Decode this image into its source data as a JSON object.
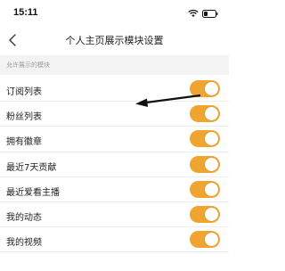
{
  "status_bar": {
    "time": "15:11",
    "icons": [
      "wifi-icon",
      "battery-icon"
    ]
  },
  "nav": {
    "back_icon": "chevron-left-icon",
    "title": "个人主页展示模块设置"
  },
  "section": {
    "header": "允许展示的模块"
  },
  "modules": [
    {
      "label": "订阅列表",
      "enabled": true
    },
    {
      "label": "粉丝列表",
      "enabled": true
    },
    {
      "label": "拥有徽章",
      "enabled": true
    },
    {
      "label": "最近7天贡献",
      "enabled": true
    },
    {
      "label": "最近爱看主播",
      "enabled": true
    },
    {
      "label": "我的动态",
      "enabled": true
    },
    {
      "label": "我的视频",
      "enabled": true
    }
  ],
  "colors": {
    "toggle_on": "#f0a531",
    "section_bg": "#f3f3f3"
  }
}
